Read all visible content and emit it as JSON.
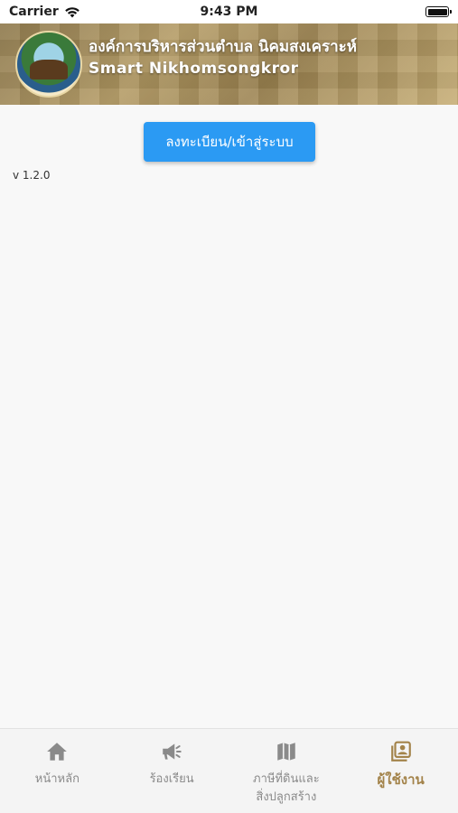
{
  "status_bar": {
    "carrier": "Carrier",
    "time": "9:43 PM"
  },
  "header": {
    "title": "องค์การบริหารส่วนตำบล นิคมสงเคราะห์",
    "subtitle": "Smart Nikhomsongkror"
  },
  "main": {
    "login_button_label": "ลงทะเบียน/เข้าสู่ระบบ",
    "version_text": "v 1.2.0"
  },
  "tabbar": {
    "tabs": [
      {
        "label": "หน้าหลัก",
        "icon": "home-icon"
      },
      {
        "label": "ร้องเรียน",
        "icon": "megaphone-icon"
      },
      {
        "label": "ภาษีที่ดินและ\nสิ่งปลูกสร้าง",
        "icon": "map-icon"
      },
      {
        "label": "ผู้ใช้งาน",
        "icon": "user-portrait-icon",
        "active": true
      }
    ],
    "active_color": "#a3834a",
    "inactive_color": "#8a8a8a"
  },
  "colors": {
    "primary_button": "#2b9af3",
    "background": "#f8f8f8"
  }
}
